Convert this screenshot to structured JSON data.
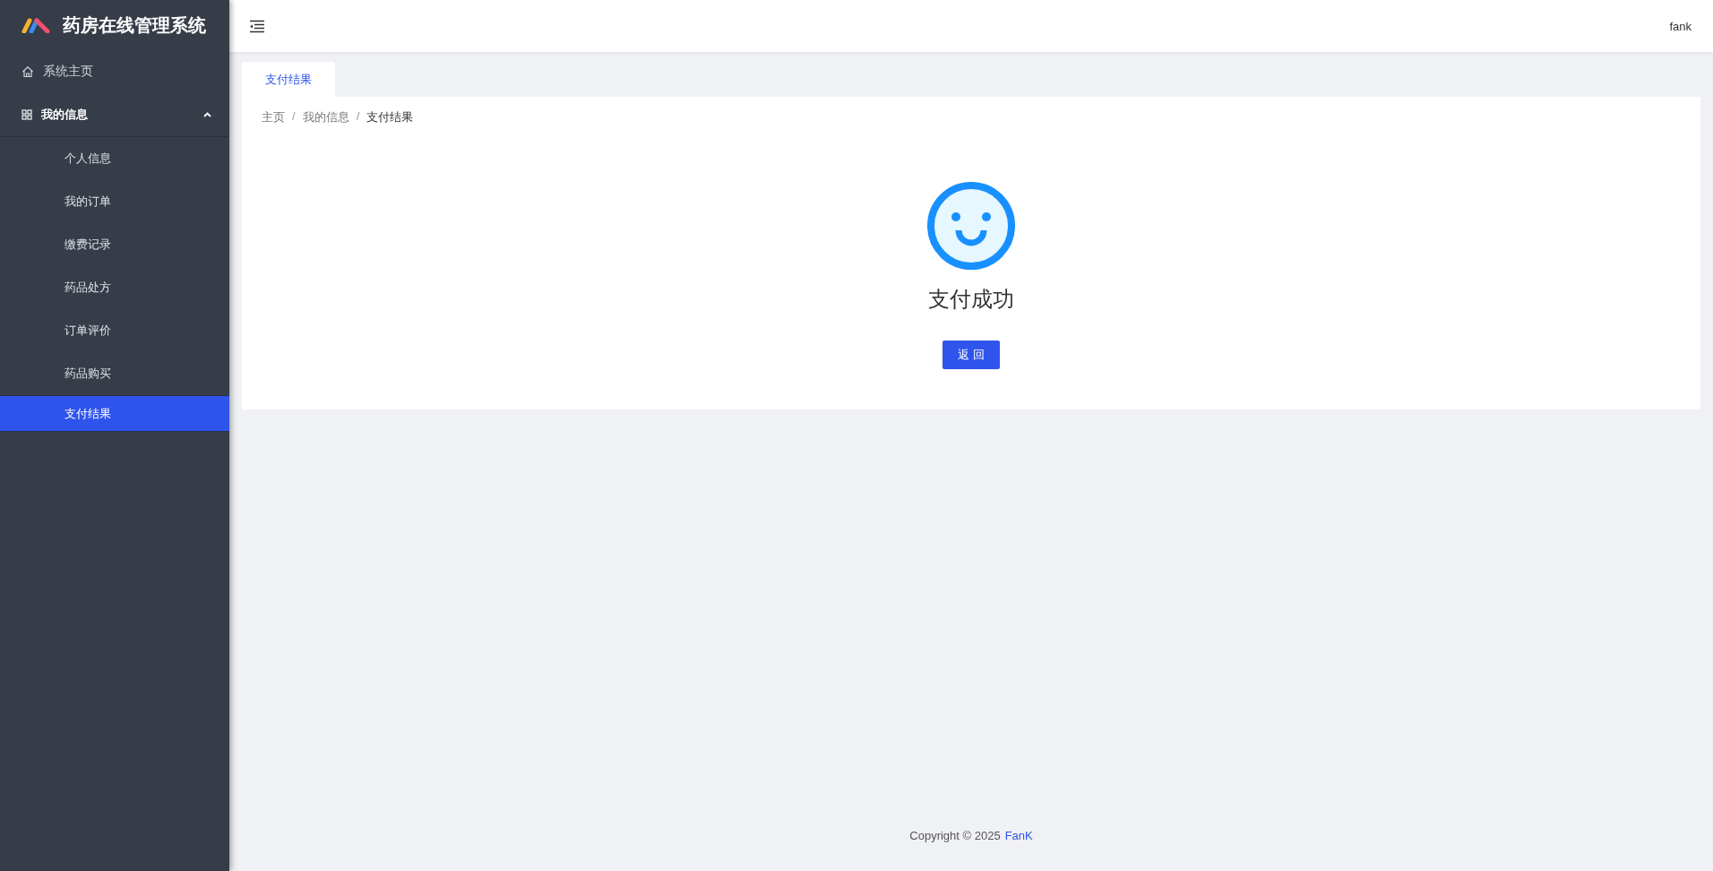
{
  "sidebar": {
    "title": "药房在线管理系统",
    "items": [
      {
        "label": "系统主页",
        "kind": "home",
        "selected": false
      },
      {
        "label": "我的信息",
        "kind": "group",
        "expanded": true,
        "children": [
          {
            "label": "个人信息",
            "selected": false
          },
          {
            "label": "我的订单",
            "selected": false
          },
          {
            "label": "缴费记录",
            "selected": false
          },
          {
            "label": "药品处方",
            "selected": false
          },
          {
            "label": "订单评价",
            "selected": false
          },
          {
            "label": "药品购买",
            "selected": false
          },
          {
            "label": "支付结果",
            "selected": true
          }
        ]
      }
    ]
  },
  "header": {
    "user": "fank"
  },
  "tabs": [
    {
      "label": "支付结果",
      "selected": true
    }
  ],
  "breadcrumb": {
    "separator": "/",
    "items": [
      "主页",
      "我的信息",
      "支付结果"
    ]
  },
  "result": {
    "title": "支付成功",
    "button": "返 回"
  },
  "footer": {
    "text": "Copyright © 2025",
    "link": "FanK"
  }
}
